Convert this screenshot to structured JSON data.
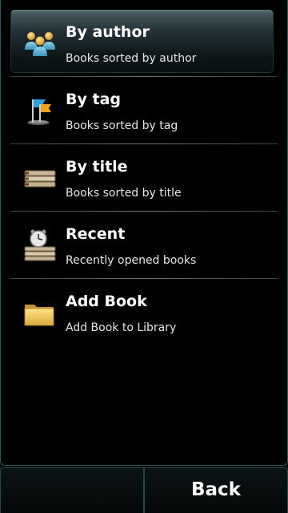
{
  "menu": {
    "items": [
      {
        "title": "By author",
        "subtitle": "Books sorted by author",
        "icon": "people-icon",
        "selected": true
      },
      {
        "title": "By tag",
        "subtitle": "Books sorted by tag",
        "icon": "flags-icon",
        "selected": false
      },
      {
        "title": "By title",
        "subtitle": "Books sorted by title",
        "icon": "book-stack-icon",
        "selected": false
      },
      {
        "title": "Recent",
        "subtitle": "Recently opened books",
        "icon": "clock-books-icon",
        "selected": false
      },
      {
        "title": "Add Book",
        "subtitle": "Add Book to Library",
        "icon": "folder-icon",
        "selected": false
      }
    ]
  },
  "softkeys": {
    "left_label": "",
    "right_label": "Back"
  },
  "colors": {
    "background": "#000000",
    "accent_border": "#2c5a60",
    "highlight_top": "#4a6064"
  }
}
